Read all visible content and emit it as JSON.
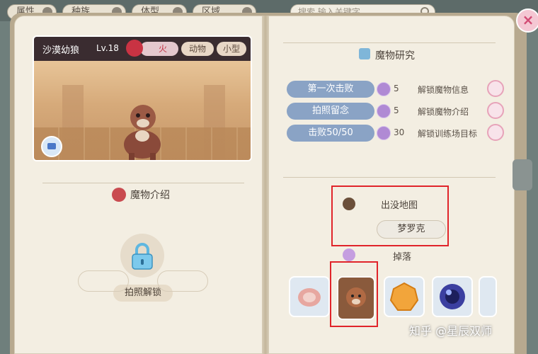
{
  "filters": [
    "属性",
    "种族",
    "体型",
    "区域"
  ],
  "search": {
    "placeholder": "搜索 输入关键字"
  },
  "close_label": "×",
  "monster": {
    "name": "沙漠幼狼",
    "level": "Lv.18",
    "element": "火",
    "tags": [
      "动物",
      "小型"
    ]
  },
  "sections": {
    "intro_title": "魔物介绍",
    "research_title": "魔物研究",
    "map_title": "出没地图",
    "drop_title": "掉落"
  },
  "unlock_label": "拍照解锁",
  "research": [
    {
      "task": "第一次击败",
      "count": "5",
      "reward": "解锁魔物信息"
    },
    {
      "task": "拍照留念",
      "count": "5",
      "reward": "解锁魔物介绍"
    },
    {
      "task": "击败50/50",
      "count": "30",
      "reward": "解锁训练场目标"
    }
  ],
  "map_location": "梦罗克",
  "drops": [
    {
      "icon": "meat-icon",
      "color": "#e7a7a0"
    },
    {
      "icon": "wolf-card-icon",
      "color": "#8a5a3c"
    },
    {
      "icon": "orange-gem-icon",
      "color": "#f2a53b"
    },
    {
      "icon": "dark-orb-icon",
      "color": "#3b3fa0"
    },
    {
      "icon": "partial-item-icon",
      "color": "#dfe8f1"
    }
  ],
  "watermark": "知乎 @星辰双师",
  "colors": {
    "highlight": "#e0242a",
    "task_button": "#8aa3c5",
    "fire": "#c93343"
  }
}
